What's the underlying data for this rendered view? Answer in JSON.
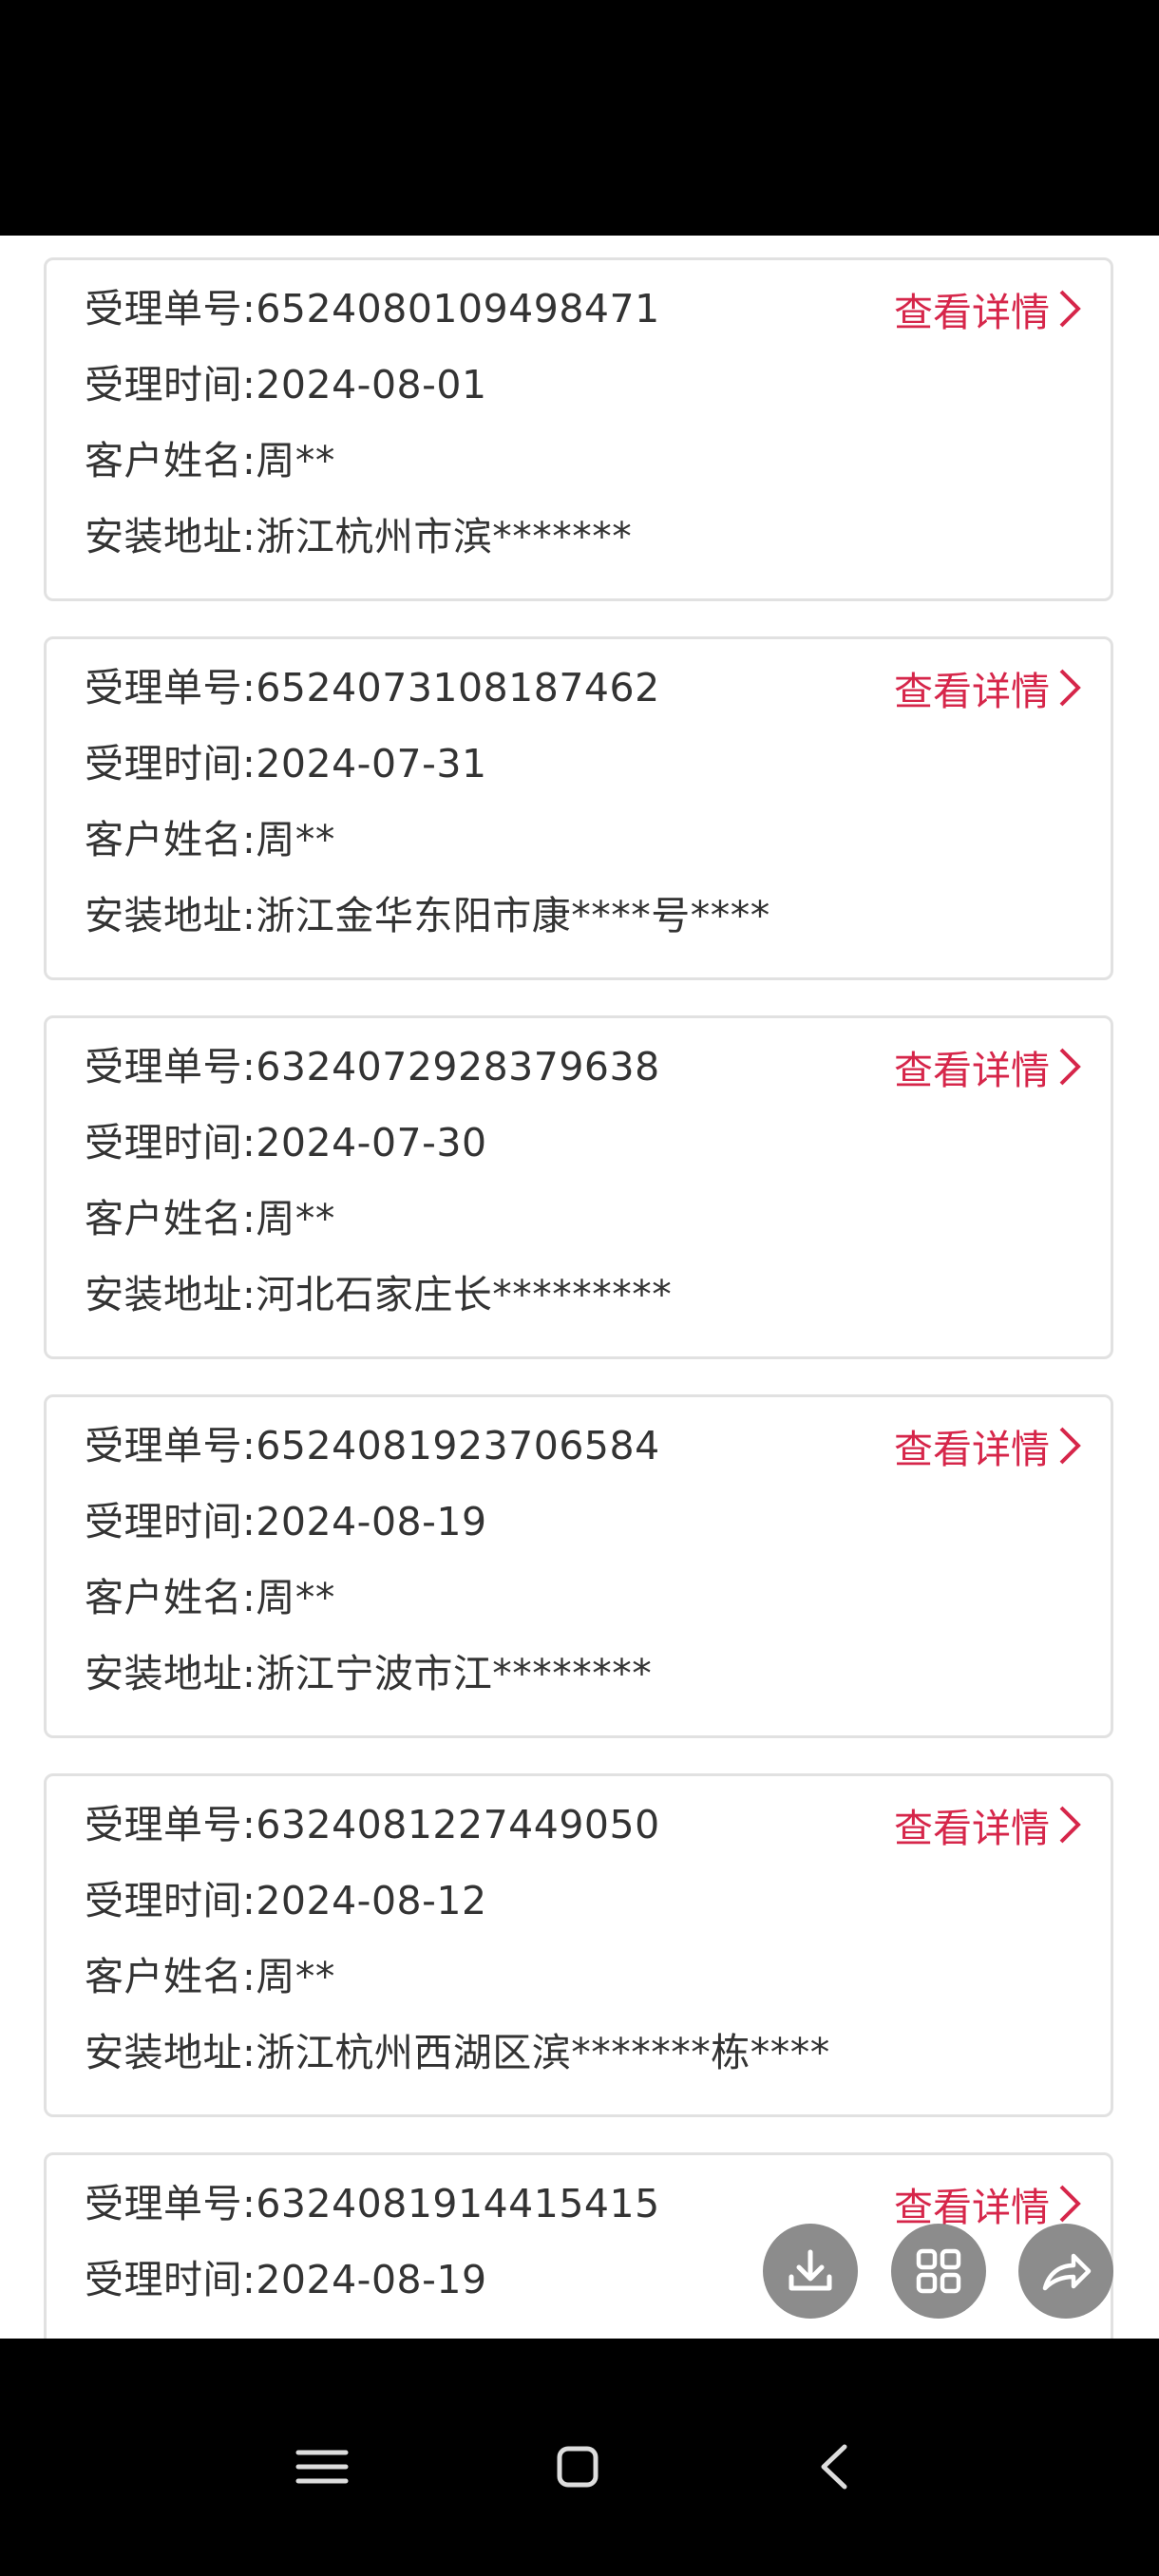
{
  "orders": [
    {
      "order_no": "受理单号:6524080109498471",
      "time": "受理时间:2024-08-01",
      "customer": "客户姓名:周**",
      "address": "安装地址:浙江杭州市滨*******",
      "detail_label": "查看详情"
    },
    {
      "order_no": "受理单号:6524073108187462",
      "time": "受理时间:2024-07-31",
      "customer": "客户姓名:周**",
      "address": "安装地址:浙江金华东阳市康****号****",
      "detail_label": "查看详情"
    },
    {
      "order_no": "受理单号:6324072928379638",
      "time": "受理时间:2024-07-30",
      "customer": "客户姓名:周**",
      "address": "安装地址:河北石家庄长*********",
      "detail_label": "查看详情"
    },
    {
      "order_no": "受理单号:6524081923706584",
      "time": "受理时间:2024-08-19",
      "customer": "客户姓名:周**",
      "address": "安装地址:浙江宁波市江********",
      "detail_label": "查看详情"
    },
    {
      "order_no": "受理单号:6324081227449050",
      "time": "受理时间:2024-08-12",
      "customer": "客户姓名:周**",
      "address": "安装地址:浙江杭州西湖区滨*******栋****",
      "detail_label": "查看详情"
    },
    {
      "order_no": "受理单号:6324081914415415",
      "time": "受理时间:2024-08-19",
      "customer": "",
      "address": "",
      "detail_label": "查看详情"
    }
  ],
  "floating_actions": [
    "download-icon",
    "grid-icon",
    "share-icon"
  ],
  "nav_buttons": [
    "menu-icon",
    "home-icon",
    "back-icon"
  ],
  "colors": {
    "accent": "#d6264a",
    "card_border": "#e1e1e1",
    "text": "#333333"
  }
}
